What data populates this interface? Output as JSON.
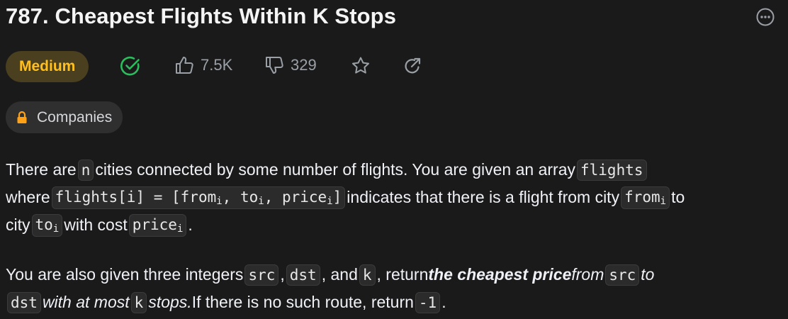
{
  "problem": {
    "title": "787. Cheapest Flights Within K Stops",
    "difficulty": "Medium"
  },
  "stats": {
    "likes": "7.5K",
    "dislikes": "329"
  },
  "companies_label": "Companies",
  "icons": [
    "more-icon",
    "solved-check-icon",
    "thumbs-up-icon",
    "thumbs-down-icon",
    "star-icon",
    "share-icon",
    "lock-icon"
  ],
  "colors": {
    "difficulty_text": "#ffc01e",
    "difficulty_bg": "#4a3f1f",
    "solved": "#2cbb5d",
    "lock": "#ffa116"
  },
  "description": {
    "p1": {
      "t1": "There are",
      "c1": "n",
      "t2": "cities connected by some number of flights. You are given an array",
      "c2": "flights",
      "t3": "where",
      "c3a": "flights[i] = [from",
      "c3b": ", to",
      "c3c": ", price",
      "c3d": "]",
      "sub_i": "i",
      "t4": "indicates that there is a flight from city",
      "c4": "from",
      "t5": "to",
      "t6": "city",
      "c5": "to",
      "t7": "with cost",
      "c6": "price",
      "t8": "."
    },
    "p2": {
      "t1": "You are also given three integers",
      "c1": "src",
      "t2": ",",
      "c2": "dst",
      "t3": ", and",
      "c3": "k",
      "t4": ", return",
      "s1": "the cheapest price",
      "i1": "from",
      "c4": "src",
      "i2": "to",
      "c5": "dst",
      "i3": "with at most",
      "c6": "k",
      "i4": "stops.",
      "t5": "If there is no such route, return",
      "c7": "-1",
      "t6": "."
    }
  }
}
